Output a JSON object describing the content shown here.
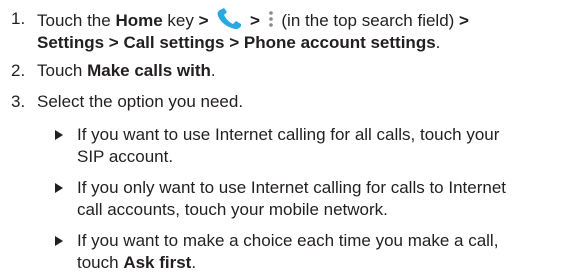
{
  "steps": [
    {
      "number": "1.",
      "prefix": "Touch the ",
      "home_key": "Home",
      "key_suffix": " key ",
      "sep1": ">",
      "sep2": ">",
      "dots_note": " (in the top search field) ",
      "sep3": ">",
      "settings": "Settings",
      "sep4": " > ",
      "call_settings": "Call settings",
      "sep5": " > ",
      "phone_account_settings": "Phone account settings",
      "end": "."
    },
    {
      "number": "2.",
      "prefix": "Touch ",
      "make_calls_with": "Make calls with",
      "end": "."
    },
    {
      "number": "3.",
      "text": "Select the option you need."
    }
  ],
  "options": [
    {
      "line1": "If you want to use Internet calling for all calls, touch your",
      "line2": "SIP account."
    },
    {
      "line1": "If you only want to use Internet calling for calls to Internet",
      "line2": "call accounts, touch your mobile network."
    },
    {
      "line1": "If you want to make a choice each time you make a call,",
      "line2_prefix": "touch ",
      "ask_first": "Ask first",
      "line2_end": "."
    }
  ],
  "icons": {
    "phone": "phone-icon",
    "menu": "vertical-dots-icon",
    "bullet": "triangle-bullet-icon"
  },
  "colors": {
    "text": "#231f20",
    "phone_icon": "#29a9e1",
    "dots_icon": "#8a8a8a"
  }
}
